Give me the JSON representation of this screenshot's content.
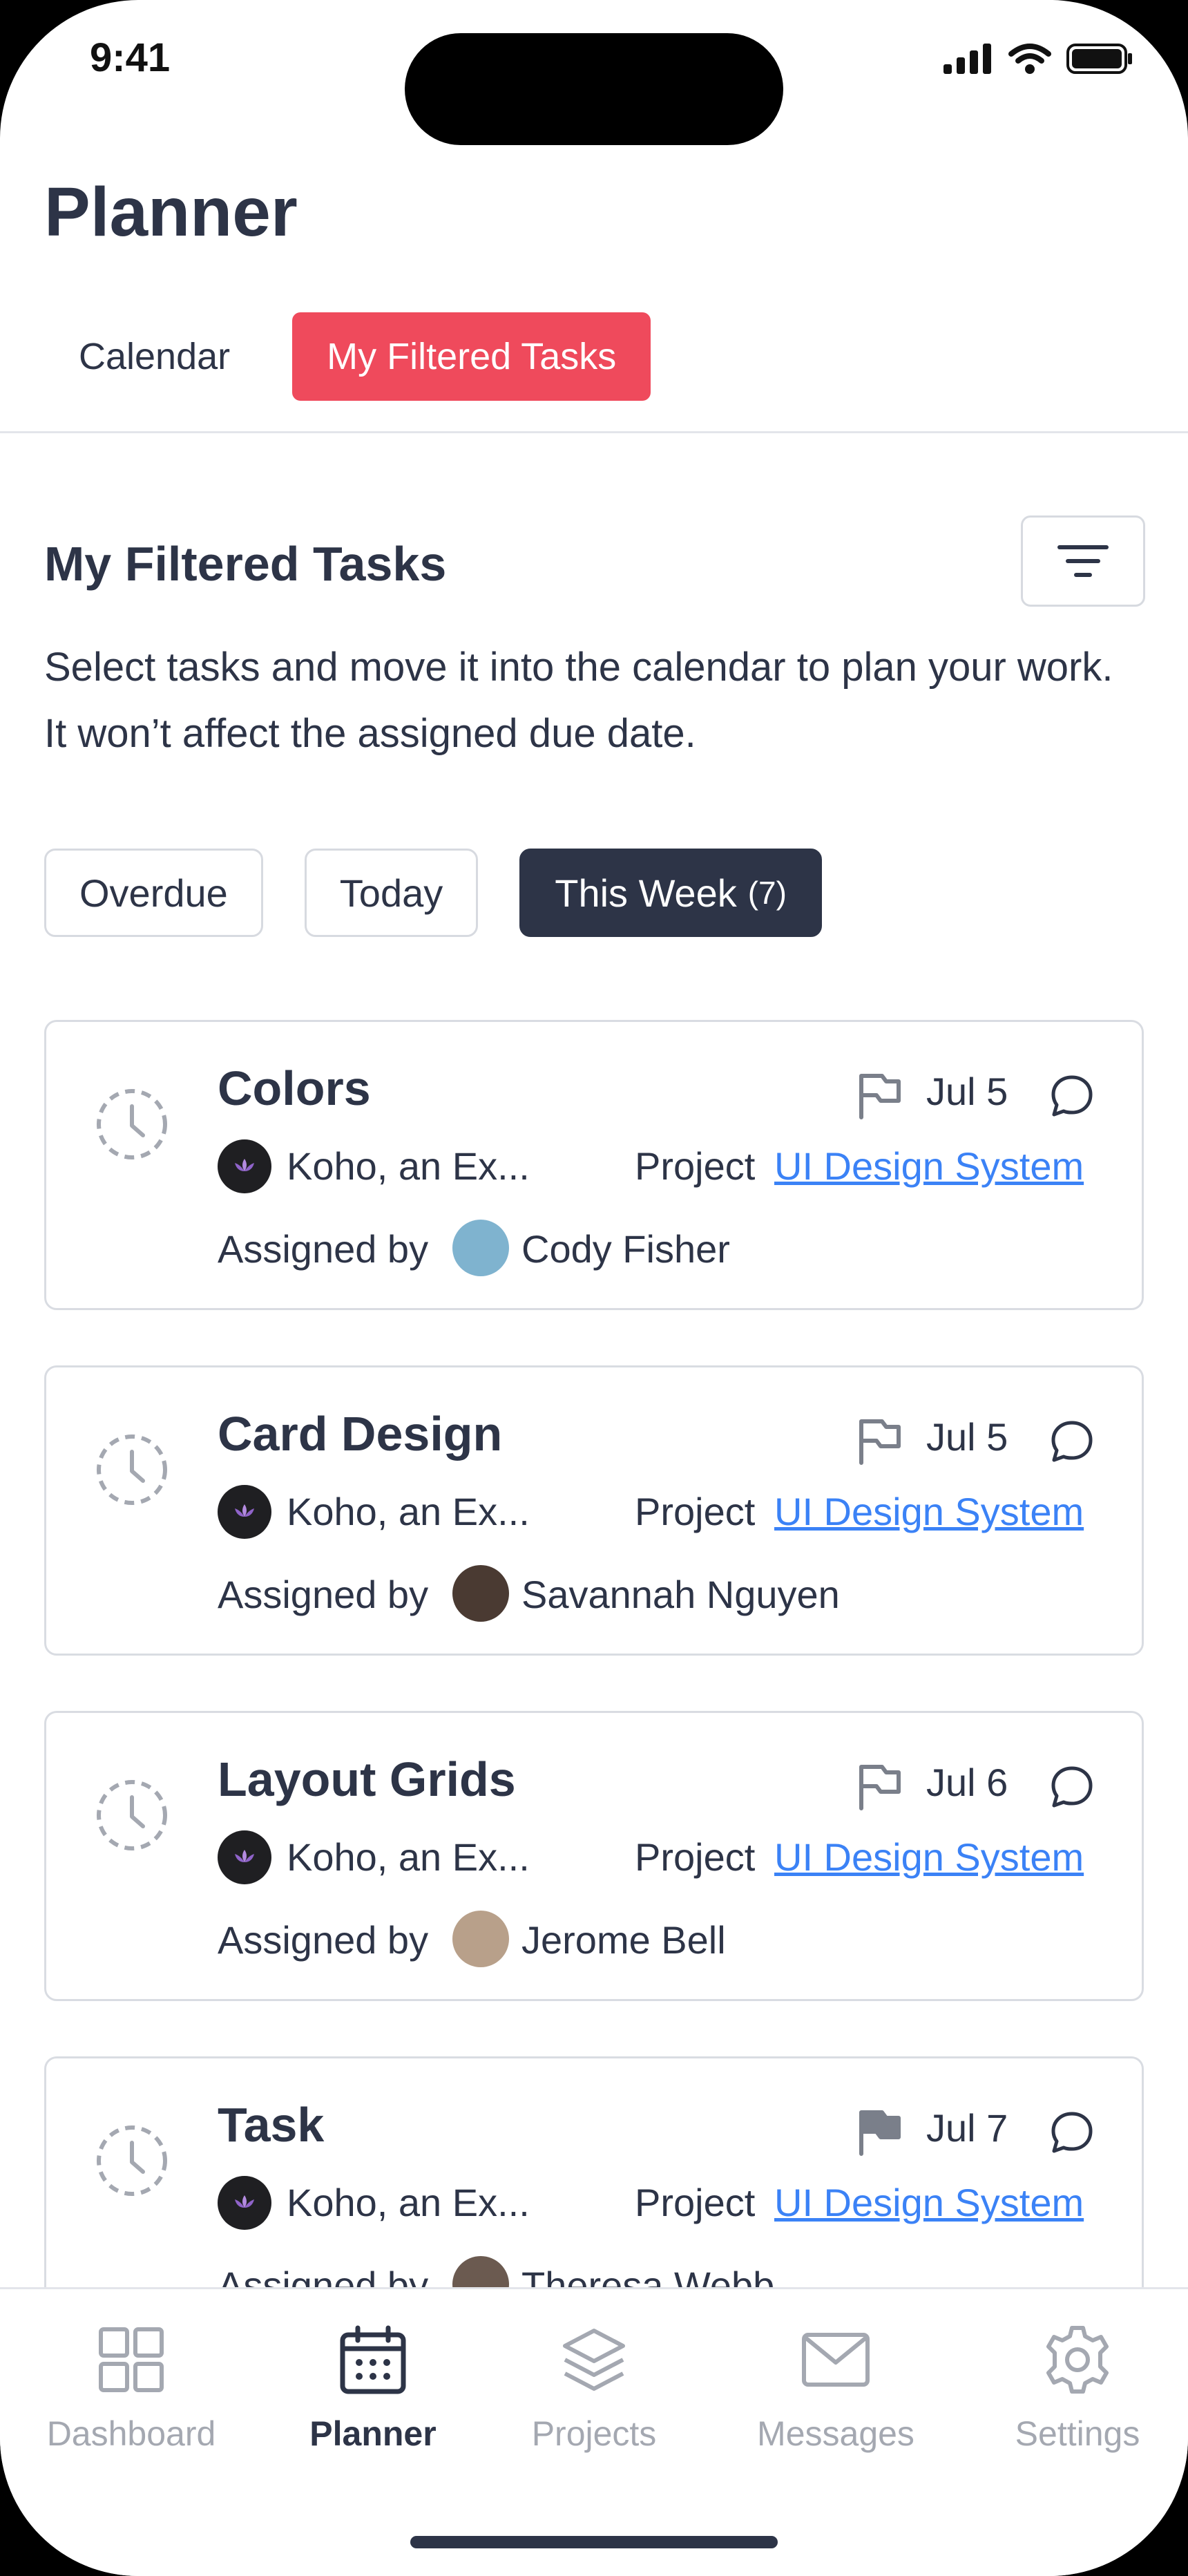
{
  "status_bar": {
    "time": "9:41"
  },
  "header": {
    "title": "Planner"
  },
  "tabs": [
    {
      "label": "Calendar",
      "active": false
    },
    {
      "label": "My Filtered Tasks",
      "active": true
    }
  ],
  "section": {
    "title": "My Filtered Tasks",
    "description": "Select tasks and move it into the calendar to plan your work. It won’t affect the assigned due date."
  },
  "filters": {
    "overdue": "Overdue",
    "today": "Today",
    "this_week": "This Week",
    "this_week_count": "(7)"
  },
  "tasks": [
    {
      "title": "Colors",
      "date": "Jul 5",
      "flag_filled": false,
      "org": "Koho, an Ex...",
      "project_label": "Project",
      "project": "UI Design System",
      "assigned_label": "Assigned by",
      "assignee": "Cody Fisher",
      "avatar_color": "#7fb3cf"
    },
    {
      "title": "Card Design",
      "date": "Jul 5",
      "flag_filled": false,
      "org": "Koho, an Ex...",
      "project_label": "Project",
      "project": "UI Design System",
      "assigned_label": "Assigned by",
      "assignee": "Savannah Nguyen",
      "avatar_color": "#4a3a32"
    },
    {
      "title": "Layout Grids",
      "date": "Jul 6",
      "flag_filled": false,
      "org": "Koho, an Ex...",
      "project_label": "Project",
      "project": "UI Design System",
      "assigned_label": "Assigned by",
      "assignee": "Jerome Bell",
      "avatar_color": "#b8a08a"
    },
    {
      "title": "Task",
      "date": "Jul 7",
      "flag_filled": true,
      "org": "Koho, an Ex...",
      "project_label": "Project",
      "project": "UI Design System",
      "assigned_label": "Assigned by",
      "assignee": "Theresa Webb",
      "avatar_color": "#6b5a50"
    }
  ],
  "bottom_nav": [
    {
      "label": "Dashboard",
      "icon": "grid-icon",
      "active": false
    },
    {
      "label": "Planner",
      "icon": "calendar-icon",
      "active": true
    },
    {
      "label": "Projects",
      "icon": "layers-icon",
      "active": false
    },
    {
      "label": "Messages",
      "icon": "mail-icon",
      "active": false
    },
    {
      "label": "Settings",
      "icon": "gear-icon",
      "active": false
    }
  ],
  "colors": {
    "accent": "#ef4a5c",
    "dark": "#2d3447",
    "link": "#3b82f6",
    "muted": "#a4a8b1"
  }
}
